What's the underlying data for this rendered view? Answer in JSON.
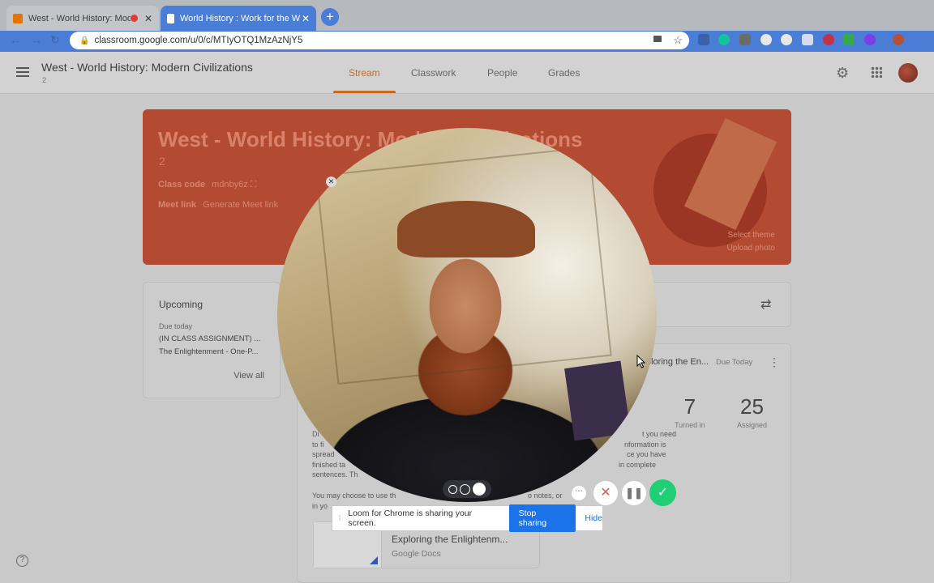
{
  "browser": {
    "tabs": [
      {
        "title": "West - World History: Mode",
        "favicon_color": "#e37400"
      },
      {
        "title": "World History : Work for the W",
        "favicon_color": "#ffffff"
      }
    ],
    "url": "classroom.google.com/u/0/c/MTIyOTQ1MzAzNjY5"
  },
  "header": {
    "class_title": "West - World History: Modern Civilizations",
    "class_section": "2",
    "tabs": [
      "Stream",
      "Classwork",
      "People",
      "Grades"
    ],
    "active_tab": "Stream"
  },
  "banner": {
    "title": "West - World History: Modern Civilizations",
    "section": "2",
    "class_code_label": "Class code",
    "class_code": "mdnby6z",
    "meet_label": "Meet link",
    "meet_action": "Generate Meet link",
    "select_theme": "Select theme",
    "upload_photo": "Upload photo",
    "color": "#b34a32"
  },
  "upcoming": {
    "heading": "Upcoming",
    "due": "Due today",
    "items": [
      "(IN CLASS ASSIGNMENT) ...",
      "The Enlightenment - One-P..."
    ],
    "view_all": "View all"
  },
  "post": {
    "title": "ploring the En...",
    "due": "Due Today",
    "turned_in_count": "7",
    "turned_in_label": "Turned in",
    "assigned_count": "25",
    "assigned_label": "Assigned",
    "text_left": [
      "Di",
      "to fi",
      "spread",
      "finished ta",
      "sentences. Th"
    ],
    "text_right": [
      "t you need",
      "nformation is",
      "ce you have",
      "in complete"
    ],
    "text_bottom": [
      "You may choose to use th",
      "o notes, or",
      "in yo"
    ],
    "attachment_title": "Exploring the Enlightenm...",
    "attachment_type": "Google Docs"
  },
  "loom": {
    "share_message": "Loom for Chrome is sharing your screen.",
    "stop_label": "Stop sharing",
    "hide_label": "Hide",
    "accent": "#1fcf73"
  }
}
